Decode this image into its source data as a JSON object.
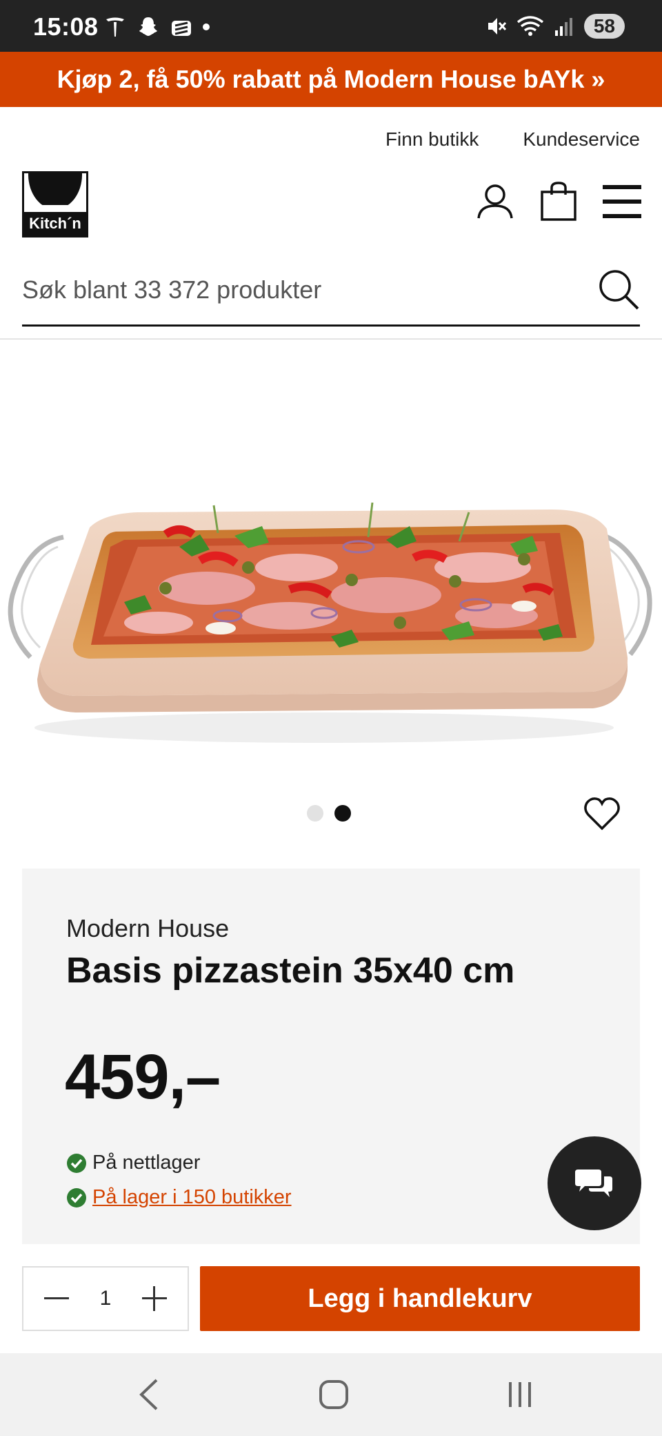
{
  "status_bar": {
    "time": "15:08",
    "battery": "58",
    "icons": [
      "tesla-icon",
      "snapchat-icon",
      "stack-icon",
      "mute-icon",
      "wifi-icon",
      "signal-icon"
    ]
  },
  "promo": {
    "text": "Kjøp 2, få 50% rabatt på Modern House bAYk »"
  },
  "top_links": {
    "find_store": "Finn butikk",
    "customer_service": "Kundeservice"
  },
  "header": {
    "logo_text": "Kitch´n",
    "icons": [
      "account-icon",
      "cart-icon",
      "menu-icon"
    ]
  },
  "search": {
    "placeholder": "Søk blant 33 372 produkter",
    "value": ""
  },
  "gallery": {
    "current": 2,
    "total": 2
  },
  "product": {
    "brand": "Modern House",
    "title": "Basis pizzastein 35x40 cm",
    "price": "459,–",
    "stock_online": "På nettlager",
    "stock_stores": "På lager i 150 butikker"
  },
  "cart": {
    "quantity": "1",
    "add_label": "Legg i handlekurv"
  },
  "colors": {
    "accent": "#d44300",
    "panel": "#f4f4f4",
    "statusbar": "#232323",
    "success": "#2e7d32"
  }
}
